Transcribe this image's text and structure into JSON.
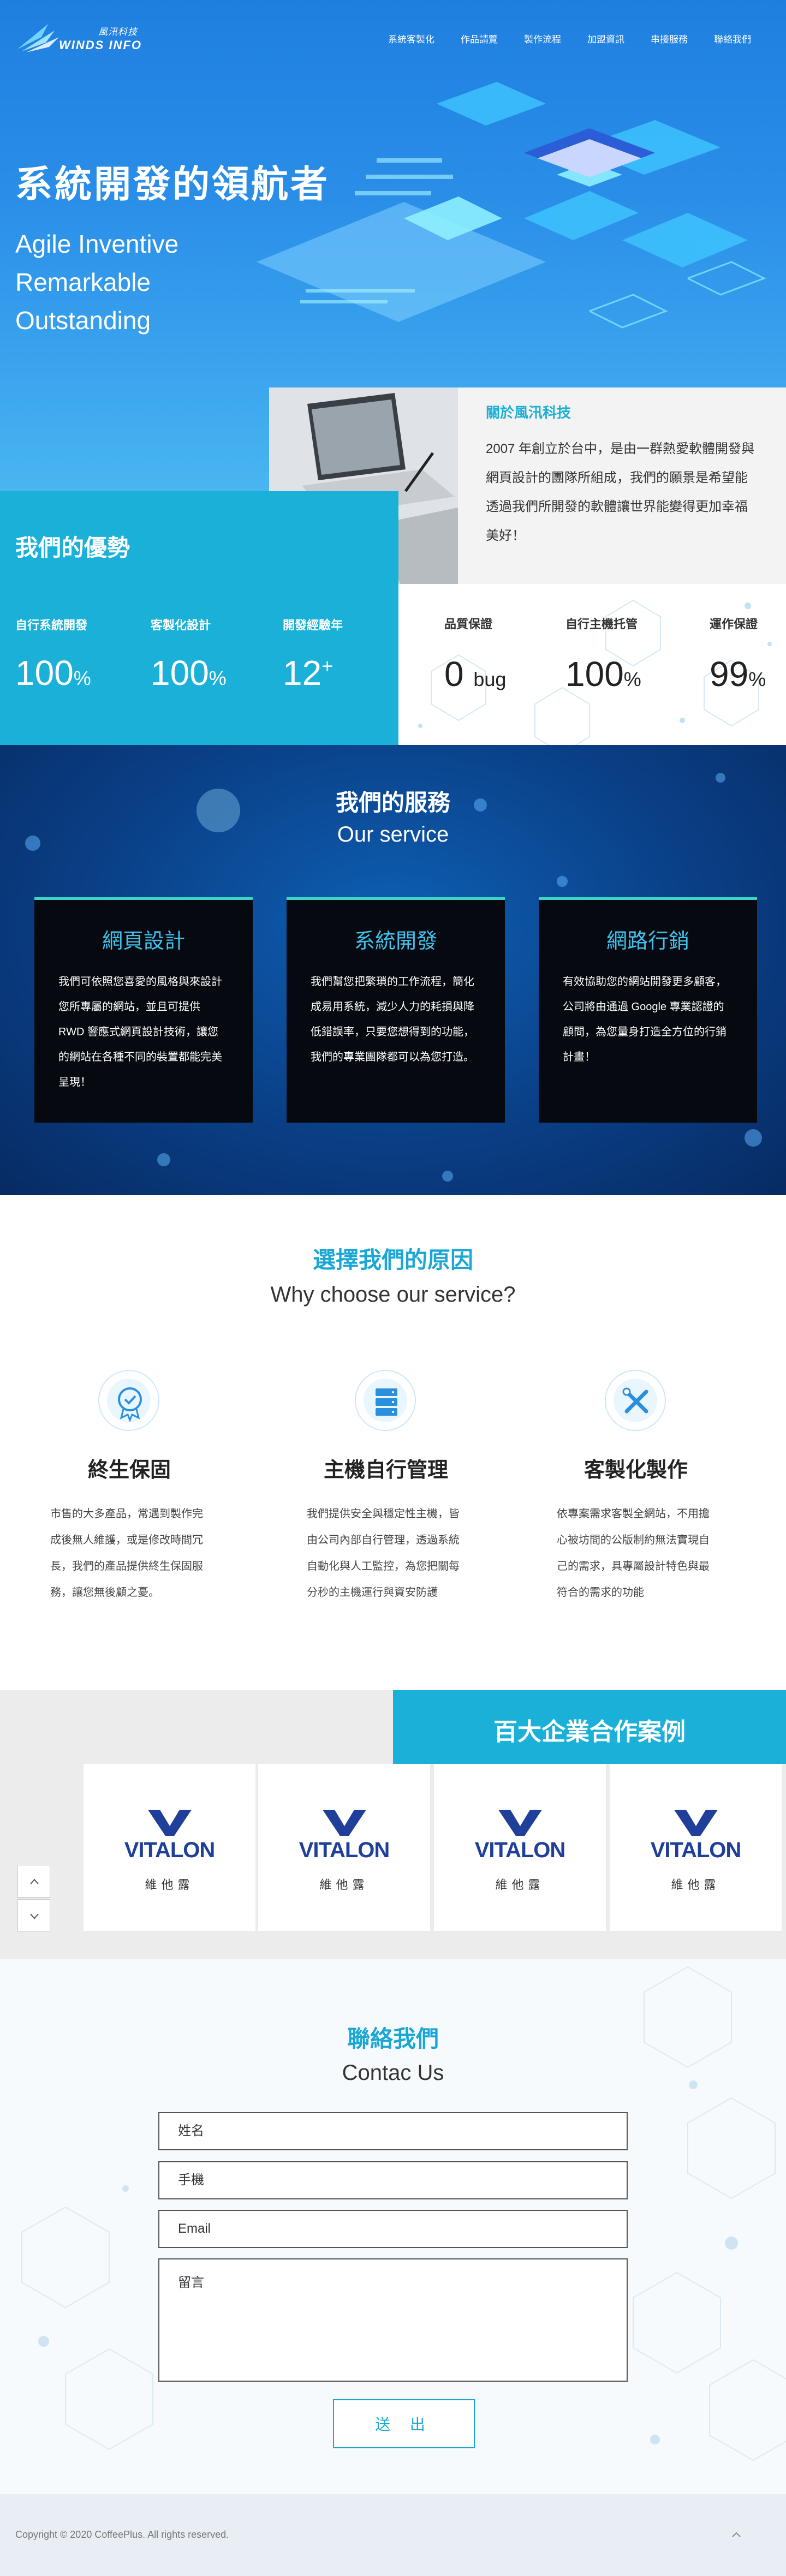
{
  "header": {
    "logo_cn": "風汛科技",
    "logo_en": "WINDS INFO",
    "nav": [
      "系統客製化",
      "作品請覽",
      "製作流程",
      "加盟資訊",
      "串接服務",
      "聯絡我們"
    ]
  },
  "hero": {
    "title": "系統開發的領航者",
    "subtitle_lines": [
      "Agile Inventive",
      "Remarkable",
      "Outstanding"
    ]
  },
  "about": {
    "title": "關於風汛科技",
    "text": "2007 年創立於台中，是由一群熱愛軟體開發與網頁設計的團隊所組成，我們的願景是希望能透過我們所開發的軟體讓世界能變得更加幸福美好！"
  },
  "advantages": {
    "title": "我們的優勢",
    "stats": [
      {
        "label": "自行系統開發",
        "num": "100",
        "unit": "%"
      },
      {
        "label": "客製化設計",
        "num": "100",
        "unit": "%"
      },
      {
        "label": "開發經驗年",
        "num": "12",
        "unit": "+"
      },
      {
        "label": "品質保證",
        "num": "0",
        "unit": "bug"
      },
      {
        "label": "自行主機托管",
        "num": "100",
        "unit": "%"
      },
      {
        "label": "運作保證",
        "num": "99",
        "unit": "%"
      }
    ]
  },
  "service": {
    "title": "我們的服務",
    "subtitle": "Our service",
    "cards": [
      {
        "title": "網頁設計",
        "text": "我們可依照您喜愛的風格與來設計您所專屬的網站，並且可提供 RWD 響應式網頁設計技術，讓您的網站在各種不同的裝置都能完美呈現！"
      },
      {
        "title": "系統開發",
        "text": "我們幫您把繁瑣的工作流程，簡化成易用系統，減少人力的耗損與降低錯誤率，只要您想得到的功能，我們的專業團隊都可以為您打造。"
      },
      {
        "title": "網路行銷",
        "text": "有效協助您的網站開發更多顧客，公司將由通過 Google 專業認證的顧問，為您量身打造全方位的行銷計畫！"
      }
    ]
  },
  "why": {
    "title": "選擇我們的原因",
    "subtitle": "Why choose our service?",
    "items": [
      {
        "icon": "badge-icon",
        "title": "終生保固",
        "text": "市售的大多產品，常遇到製作完成後無人維護，或是修改時間冗長，我們的產品提供終生保固服務，讓您無後顧之憂。"
      },
      {
        "icon": "server-icon",
        "title": "主機自行管理",
        "text": "我們提供安全與穩定性主機，皆由公司內部自行管理，透過系統自動化與人工監控，為您把關每分秒的主機運行與資安防護"
      },
      {
        "icon": "tools-icon",
        "title": "客製化製作",
        "text": "依專案需求客製全網站，不用擔心被坊間的公版制約無法實現自己的需求，具專屬設計特色與最符合的需求的功能"
      }
    ]
  },
  "partners": {
    "title": "百大企業合作案例",
    "logos": [
      {
        "name": "VITALON",
        "cn": "維他露"
      },
      {
        "name": "VITALON",
        "cn": "維他露"
      },
      {
        "name": "VITALON",
        "cn": "維他露"
      },
      {
        "name": "VITALON",
        "cn": "維他露"
      }
    ]
  },
  "contact": {
    "title": "聯絡我們",
    "subtitle": "Contac Us",
    "name_placeholder": "姓名",
    "phone_placeholder": "手機",
    "email_placeholder": "Email",
    "message_placeholder": "留言",
    "submit": "送 出"
  },
  "footer": {
    "copyright": "Copyright © 2020 CoffeePlus. All rights reserved."
  },
  "colors": {
    "primary": "#1ab0d8",
    "hero": "#2a8ee8",
    "service_bg": "#0a3f86",
    "accent_text": "#1aa7d6"
  }
}
